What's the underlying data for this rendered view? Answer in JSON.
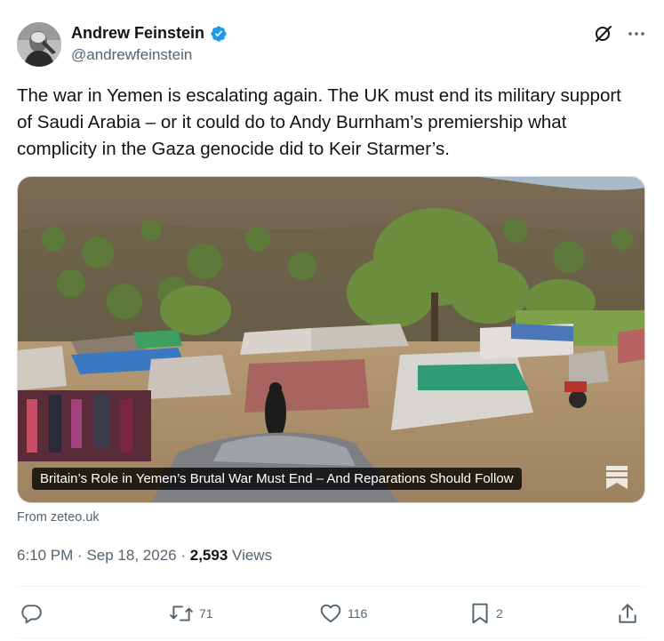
{
  "author": {
    "display_name": "Andrew Feinstein",
    "handle": "@andrewfeinstein",
    "verified": true,
    "avatar_icon": "avatar-photo"
  },
  "tweet": {
    "text": "The war in Yemen is escalating again. The UK must end its military support of Saudi Arabia – or it could do to Andy Burnham’s premiership what complicity in the Gaza genocide did to Keir Starmer’s."
  },
  "card": {
    "title": "Britain’s Role in Yemen’s Brutal War Must End – And Reparations Should Follow",
    "source": "From zeteo.uk",
    "image_icon": "displacement-camp-photo"
  },
  "meta": {
    "time": "6:10 PM",
    "separator": "·",
    "date": "Sep 18, 2026",
    "views_count": "2,593",
    "views_label": "Views"
  },
  "actions": {
    "replies": "",
    "reposts": "71",
    "likes": "116",
    "bookmarks": "2"
  },
  "colors": {
    "text": "#0f1419",
    "secondary": "#536471",
    "verified": "#1d9bf0",
    "border": "#cfd9de"
  }
}
